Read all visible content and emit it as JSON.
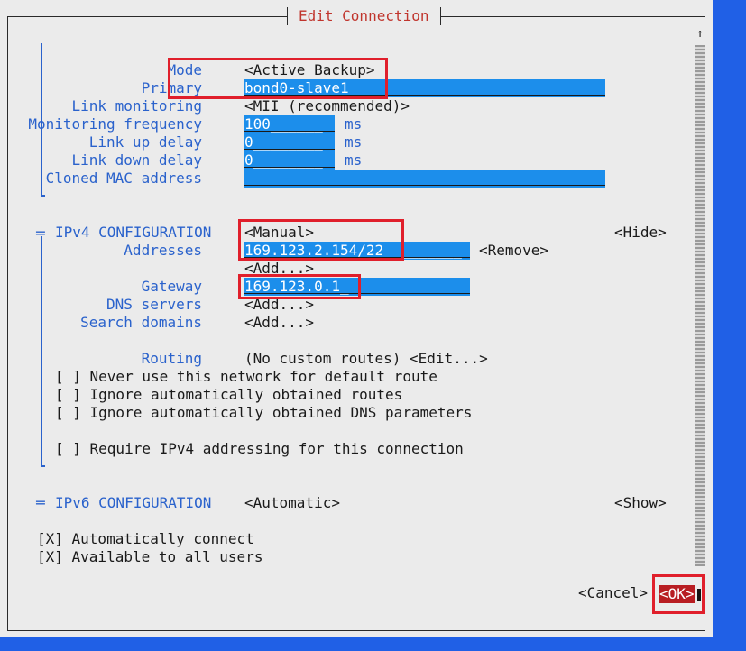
{
  "title": "Edit Connection",
  "bond": {
    "mode_label": "Mode",
    "mode_value": "<Active Backup>",
    "primary_label": "Primary",
    "primary_value": "bond0-slave1",
    "link_monitoring_label": "Link monitoring",
    "link_monitoring_value": "<MII (recommended)>",
    "monitoring_frequency_label": "Monitoring frequency",
    "monitoring_frequency_value": "100______",
    "link_up_delay_label": "Link up delay",
    "link_up_delay_value": "0________",
    "link_down_delay_label": "Link down delay",
    "link_down_delay_value": "0________",
    "cloned_mac_label": "Cloned MAC address",
    "cloned_mac_value": "",
    "unit_ms": "ms"
  },
  "ipv4": {
    "marker": "═",
    "header": "IPv4 CONFIGURATION",
    "method": "<Manual>",
    "toggle": "<Hide>",
    "addresses_label": "Addresses",
    "address_value": "169.123.2.154/22_________",
    "remove_button": "<Remove>",
    "add_address": "<Add...>",
    "gateway_label": "Gateway",
    "gateway_value": "169.123.0.1_",
    "dns_label": "DNS servers",
    "dns_add": "<Add...>",
    "search_label": "Search domains",
    "search_add": "<Add...>",
    "routing_label": "Routing",
    "routing_value": "(No custom routes) <Edit...>",
    "never_default_route": "[ ] Never use this network for default route",
    "ignore_routes": "[ ] Ignore automatically obtained routes",
    "ignore_dns": "[ ] Ignore automatically obtained DNS parameters",
    "require_ipv4": "[ ] Require IPv4 addressing for this connection"
  },
  "ipv6": {
    "marker": "═",
    "header": "IPv6 CONFIGURATION",
    "method": "<Automatic>",
    "toggle": "<Show>"
  },
  "general": {
    "auto_connect": "[X] Automatically connect",
    "all_users": "[X] Available to all users"
  },
  "actions": {
    "cancel": "<Cancel>",
    "ok": "<OK>"
  },
  "scroll_arrow": "↑",
  "colors": {
    "background": "#2060e6",
    "dialog": "#ebebeb",
    "label": "#2a62cc",
    "field": "#1c8eeb",
    "callout": "#e01f2b",
    "ok_button": "#b81d22"
  }
}
